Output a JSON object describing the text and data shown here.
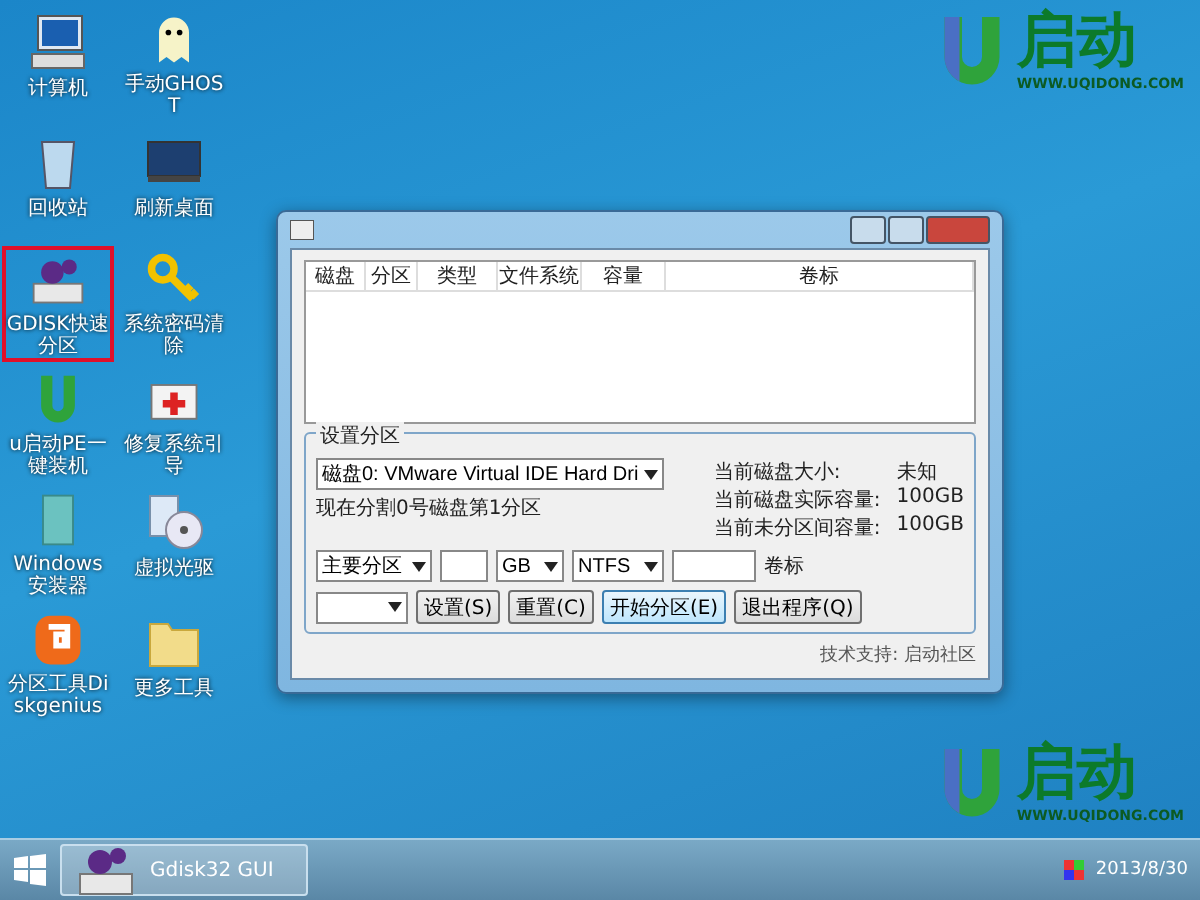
{
  "desktop_icons": [
    {
      "kind": "computer",
      "label": "计算机",
      "selected": false
    },
    {
      "kind": "ghost",
      "label": "手动GHOST",
      "selected": false
    },
    {
      "kind": "bin",
      "label": "回收站",
      "selected": false
    },
    {
      "kind": "screen",
      "label": "刷新桌面",
      "selected": false
    },
    {
      "kind": "disk",
      "label": "GDISK快速分区",
      "selected": true
    },
    {
      "kind": "key",
      "label": "系统密码清除",
      "selected": false
    },
    {
      "kind": "ulogo",
      "label": "u启动PE一键装机",
      "selected": false
    },
    {
      "kind": "kit",
      "label": "修复系统引导",
      "selected": false
    },
    {
      "kind": "book",
      "label": "Windows安装器",
      "selected": false
    },
    {
      "kind": "cd",
      "label": "虚拟光驱",
      "selected": false
    },
    {
      "kind": "dg",
      "label": "分区工具Diskgenius",
      "selected": false
    },
    {
      "kind": "folder",
      "label": "更多工具",
      "selected": false
    }
  ],
  "logos": [
    {
      "brand": "启动",
      "url": "WWW.UQIDONG.COM"
    },
    {
      "brand": "启动",
      "url": "WWW.UQIDONG.COM"
    }
  ],
  "dialog": {
    "columns": [
      "磁盘",
      "分区",
      "类型",
      "文件系统",
      "容量",
      "卷标"
    ],
    "group_title": "设置分区",
    "disk_select": "磁盘0: VMware Virtual IDE Hard Dri",
    "status": "现在分割0号磁盘第1分区",
    "info": [
      {
        "label": "当前磁盘大小:",
        "value": "未知"
      },
      {
        "label": "当前磁盘实际容量:",
        "value": "100GB"
      },
      {
        "label": "当前未分区间容量:",
        "value": "100GB"
      }
    ],
    "partition_type": "主要分区",
    "unit": "GB",
    "filesystem": "NTFS",
    "volume_label": "卷标",
    "buttons": [
      {
        "label": "设置(S)",
        "selected": false
      },
      {
        "label": "重置(C)",
        "selected": false
      },
      {
        "label": "开始分区(E)",
        "selected": true
      },
      {
        "label": "退出程序(Q)",
        "selected": false
      }
    ],
    "footer": "技术支持: 启动社区"
  },
  "taskbar": {
    "task": "Gdisk32 GUI",
    "date": "2013/8/30"
  }
}
